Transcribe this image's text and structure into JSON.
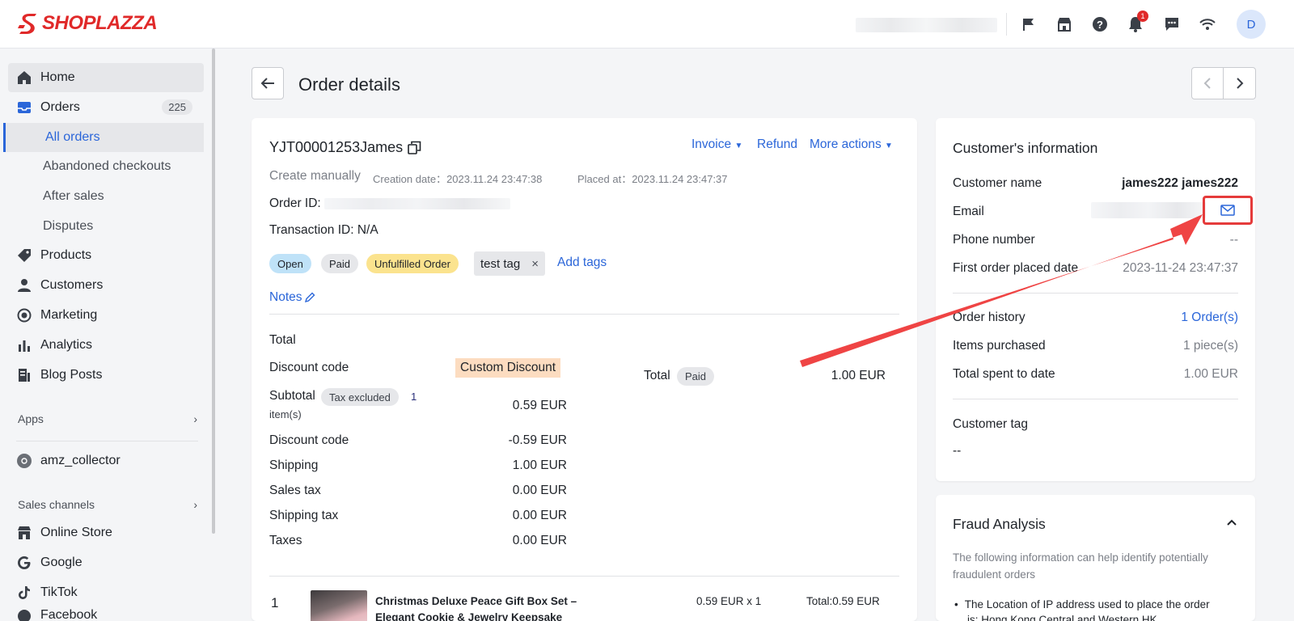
{
  "brand": {
    "name": "SHOPLAZZA",
    "color": "#e02929",
    "accent": "#2b66d9"
  },
  "topbar": {
    "notifications_count": "1",
    "avatar_initial": "D"
  },
  "sidebar": {
    "home": "Home",
    "orders": "Orders",
    "orders_count": "225",
    "orders_sub": [
      "All orders",
      "Abandoned checkouts",
      "After sales",
      "Disputes"
    ],
    "products": "Products",
    "customers": "Customers",
    "marketing": "Marketing",
    "analytics": "Analytics",
    "blog_posts": "Blog Posts",
    "apps_heading": "Apps",
    "app_item": "amz_collector",
    "sales_channels_heading": "Sales channels",
    "channels": [
      "Online Store",
      "Google",
      "TikTok",
      "Facebook"
    ]
  },
  "page": {
    "title": "Order details"
  },
  "order": {
    "number": "YJT00001253James",
    "actions": {
      "invoice": "Invoice",
      "refund": "Refund",
      "more": "More actions"
    },
    "source": "Create manually",
    "creation_date_label": "Creation date：",
    "creation_date": "2023.11.24 23:47:38",
    "placed_at_label": "Placed at：",
    "placed_at": "2023.11.24 23:47:37",
    "order_id_label": "Order ID:",
    "transaction_id": "Transaction ID: N/A",
    "tags": {
      "open": "Open",
      "paid": "Paid",
      "unfulfilled": "Unfulfilled Order",
      "custom": "test tag",
      "add": "Add tags"
    },
    "notes": "Notes"
  },
  "totals": {
    "heading": "Total",
    "discount_code_label": "Discount code",
    "discount_code_value": "Custom Discount",
    "subtotal_label": "Subtotal",
    "tax_excluded": "Tax excluded",
    "items_count_num": "1",
    "items_count_unit": "item(s)",
    "subtotal": "0.59 EUR",
    "discount_label": "Discount code",
    "discount": "-0.59 EUR",
    "shipping_label": "Shipping",
    "shipping": "1.00 EUR",
    "sales_tax_label": "Sales tax",
    "sales_tax": "0.00 EUR",
    "shipping_tax_label": "Shipping tax",
    "shipping_tax": "0.00 EUR",
    "taxes_label": "Taxes",
    "taxes": "0.00 EUR",
    "total_label": "Total",
    "total_status": "Paid",
    "total": "1.00 EUR"
  },
  "line_item": {
    "index": "1",
    "title_line1": "Christmas Deluxe Peace Gift Box Set –",
    "title_line2": "Elegant Cookie & Jewelry Keepsake",
    "price_qty": "0.59 EUR x 1",
    "line_total": "Total:0.59 EUR"
  },
  "customer": {
    "heading": "Customer's information",
    "name_label": "Customer name",
    "name": "james222 james222",
    "email_label": "Email",
    "phone_label": "Phone number",
    "phone": "--",
    "first_order_label": "First order placed date",
    "first_order": "2023-11-24 23:47:37",
    "history_label": "Order history",
    "history": "1 Order(s)",
    "items_label": "Items purchased",
    "items": "1 piece(s)",
    "spent_label": "Total spent to date",
    "spent": "1.00 EUR",
    "tag_label": "Customer tag",
    "tag_value": "--"
  },
  "fraud": {
    "heading": "Fraud Analysis",
    "desc_line1": "The following information can help identify potentially",
    "desc_line2": "fraudulent orders",
    "bullet_line1": "The Location of IP address used to place the order",
    "bullet_line2": "is: Hong Kong Central and Western HK"
  }
}
